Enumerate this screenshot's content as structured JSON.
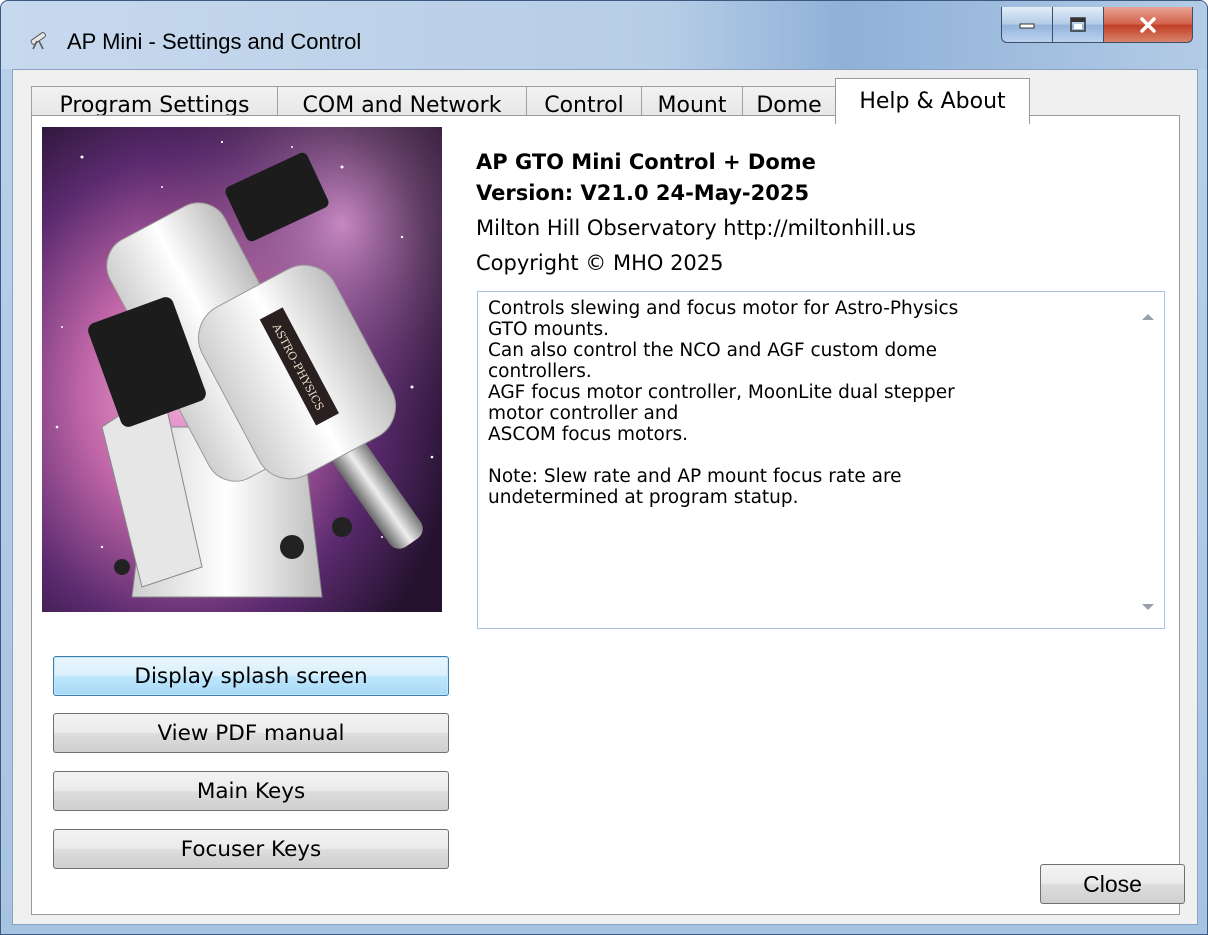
{
  "window": {
    "title": "AP Mini - Settings and Control"
  },
  "tabs": [
    {
      "label": "Program Settings",
      "active": false
    },
    {
      "label": "COM and Network",
      "active": false
    },
    {
      "label": "Control",
      "active": false
    },
    {
      "label": "Mount",
      "active": false
    },
    {
      "label": "Dome",
      "active": false
    },
    {
      "label": "Help & About",
      "active": true
    }
  ],
  "about": {
    "product": "AP GTO Mini Control + Dome",
    "version": "Version: V21.0  24-May-2025",
    "org": "Milton Hill Observatory  http://miltonhill.us",
    "copyright": "Copyright © MHO 2025",
    "description": "Controls slewing and focus motor for Astro-Physics\nGTO mounts.\nCan also control the NCO and AGF custom dome\ncontrollers.\nAGF focus motor controller, MoonLite dual stepper\nmotor controller and\nASCOM focus motors.\n\nNote: Slew rate and AP mount focus rate are\nundetermined at program statup."
  },
  "buttons": {
    "splash": "Display splash screen",
    "pdf": "View PDF manual",
    "main_keys": "Main Keys",
    "focuser_keys": "Focuser Keys",
    "close": "Close"
  },
  "image": {
    "badge_text": "ASTRO-PHYSICS"
  },
  "icons": {
    "app": "telescope-app-icon",
    "minimize": "minimize-icon",
    "maximize": "maximize-icon",
    "close": "close-icon"
  }
}
